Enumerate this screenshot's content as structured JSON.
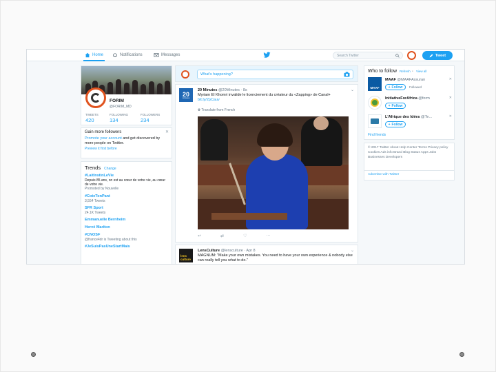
{
  "colors": {
    "twitter_blue": "#1da1f2",
    "brand_orange": "#e0531f",
    "text_dark": "#14171a",
    "text_gray": "#657786",
    "bg_light": "#f5f8fa"
  },
  "topnav": {
    "home_label": "Home",
    "notifications_label": "Notifications",
    "messages_label": "Messages",
    "search_placeholder": "Search Twitter",
    "tweet_button_label": "Tweet",
    "icons": [
      "home-icon",
      "bell-icon",
      "envelope-icon",
      "twitter-bird-icon",
      "search-icon",
      "compose-icon"
    ]
  },
  "profile": {
    "name": "FORIM",
    "handle": "@FORIM_MD",
    "stats": [
      {
        "label": "TWEETS",
        "value": "420"
      },
      {
        "label": "FOLLOWING",
        "value": "134"
      },
      {
        "label": "FOLLOWERS",
        "value": "234"
      }
    ]
  },
  "promo": {
    "title": "Gain more followers",
    "body_link": "Promote your account",
    "body_rest": "and get discovered by more people on Twitter.",
    "cta": "Preview it first before"
  },
  "trends": {
    "title": "Trends",
    "change_label": "Change",
    "items": [
      {
        "name": "#LaitInstinLeVie",
        "desc": "Depuis 85 ans, on est au cœur de votre vie, au cœur de votre vie.",
        "meta": "Promoted by Nouvelle"
      },
      {
        "name": "#CoteTonPant",
        "desc": "",
        "meta": "3,554 Tweets"
      },
      {
        "name": "SFR Sport",
        "desc": "",
        "meta": "24.1K Tweets"
      },
      {
        "name": "Emmanuelle Bernheim",
        "desc": "",
        "meta": ""
      },
      {
        "name": "Hervé Mariton",
        "desc": "",
        "meta": ""
      },
      {
        "name": "#CNOSF",
        "desc": "",
        "meta": "@france4dr is Tweeting about this"
      },
      {
        "name": "#JeSuisPasUneStartMais",
        "desc": "",
        "meta": ""
      }
    ]
  },
  "compose": {
    "placeholder": "What's happening?"
  },
  "tweets": [
    {
      "author": "20 Minutes",
      "handle": "@20Minutes",
      "time": "8s",
      "avatar_text": "20",
      "avatar_sub": "minutes",
      "text": "Myriam El Khomri invalide le licenciement du créateur du «Zapping» de Canal+",
      "link": "bit.ly/2pCauv",
      "translate": "Translate from French"
    },
    {
      "author": "LensCulture",
      "handle": "@lensculture",
      "time": "Apr 8",
      "avatar_text": "lens culture",
      "text": "MAGNUM: \"Make your own mistakes. You need to have your own experience & nobody else can really tell you what to do.\""
    }
  ],
  "who_to_follow": {
    "title": "Who to follow",
    "refresh_label": "Refresh",
    "view_all_label": "View all",
    "follow_label": "Follow",
    "items": [
      {
        "name": "MAAF",
        "handle": "@MAAFAssuran",
        "followed_by": "Followed",
        "avatar_text": "MAAF",
        "avatar_color": "#0a5aa3"
      },
      {
        "name": "InitiativeForAfrica",
        "handle": "@form",
        "followed_by": "",
        "avatar_text": "",
        "avatar_color": "#4b9b3b"
      },
      {
        "name": "L'Afrique des Idées",
        "handle": "@Te...",
        "followed_by": "",
        "avatar_text": "",
        "avatar_color": "#2b7aa8"
      }
    ],
    "find_friends": "Find friends"
  },
  "footer": {
    "text": "© 2017 Twitter About Help Center Terms Privacy policy Cookies Ads info Brand Blog Status Apps Jobs Businesses Developers",
    "advertise": "Advertise with Twitter"
  },
  "tweet_actions": [
    "reply-icon",
    "retweet-icon",
    "like-icon",
    "more-icon"
  ]
}
